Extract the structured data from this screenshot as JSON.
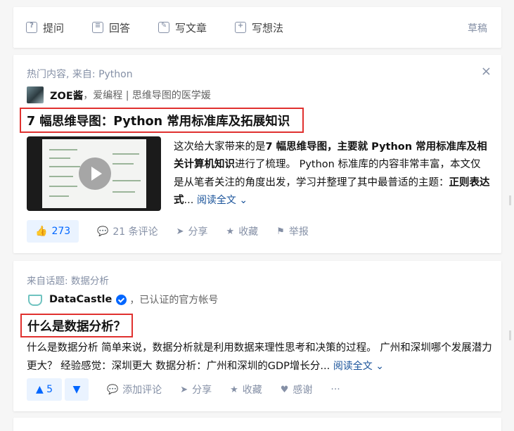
{
  "topbar": {
    "items": [
      {
        "icon": "question-icon",
        "label": "提问"
      },
      {
        "icon": "answer-icon",
        "label": "回答"
      },
      {
        "icon": "pen-icon",
        "label": "写文章"
      },
      {
        "icon": "idea-icon",
        "label": "写想法"
      }
    ],
    "draft": "草稿"
  },
  "card1": {
    "source": "热门内容, 来自: Python",
    "close": "×",
    "author_name": "ZOE酱",
    "author_headline": "，爱编程 | 思维导图的医学媛",
    "title": "7 幅思维导图：Python 常用标准库及拓展知识",
    "excerpt_plain_1": "这次给大家带来的是",
    "excerpt_bold_1": "7 幅思维导图，主要就 Python 常用标准库及相关计算机知识",
    "excerpt_plain_2": "进行了梳理。 Python 标准库的内容非常丰富，本文仅是从笔者关注的角度出发，学习并整理了其中最普适的主题：",
    "excerpt_bold_2": "正则表达式",
    "excerpt_ellipsis": "...",
    "read_more": "阅读全文",
    "vote_count": "273",
    "comments": "21 条评论",
    "share": "分享",
    "collect": "收藏",
    "report": "举报"
  },
  "card2": {
    "source": "来自话题: 数据分析",
    "author_name": "DataCastle",
    "author_headline": "，已认证的官方帐号",
    "title": "什么是数据分析？",
    "excerpt": "什么是数据分析 简单来说，数据分析就是利用数据来理性思考和决策的过程。 广州和深圳哪个发展潜力更大？ 经验感觉：深圳更大 数据分析：广州和深圳的GDP增长分...",
    "read_more": "阅读全文",
    "vote_up": "▲ 5",
    "vote_down": "▼",
    "add_comment": "添加评论",
    "share": "分享",
    "collect": "收藏",
    "thanks": "感谢",
    "more": "···"
  },
  "colors": {
    "accent": "#0066ff",
    "highlight_border": "#e0312f",
    "meta": "#8590a6"
  }
}
